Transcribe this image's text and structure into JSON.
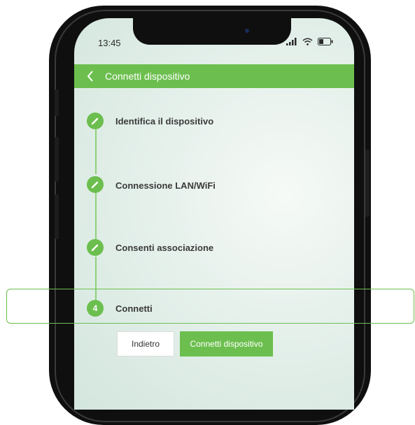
{
  "status_bar": {
    "time": "13:45"
  },
  "header": {
    "title": "Connetti dispositivo"
  },
  "steps": [
    {
      "label": "Identifica il dispositivo",
      "status": "done",
      "icon": "pencil-icon"
    },
    {
      "label": "Connessione LAN/WiFi",
      "status": "done",
      "icon": "pencil-icon"
    },
    {
      "label": "Consenti associazione",
      "status": "done",
      "icon": "pencil-icon"
    },
    {
      "label": "Connetti",
      "status": "current",
      "number": "4"
    }
  ],
  "actions": {
    "back_label": "Indietro",
    "connect_label": "Connetti dispositivo"
  },
  "colors": {
    "accent": "#6cbf4e",
    "text": "#3a3a3a"
  }
}
